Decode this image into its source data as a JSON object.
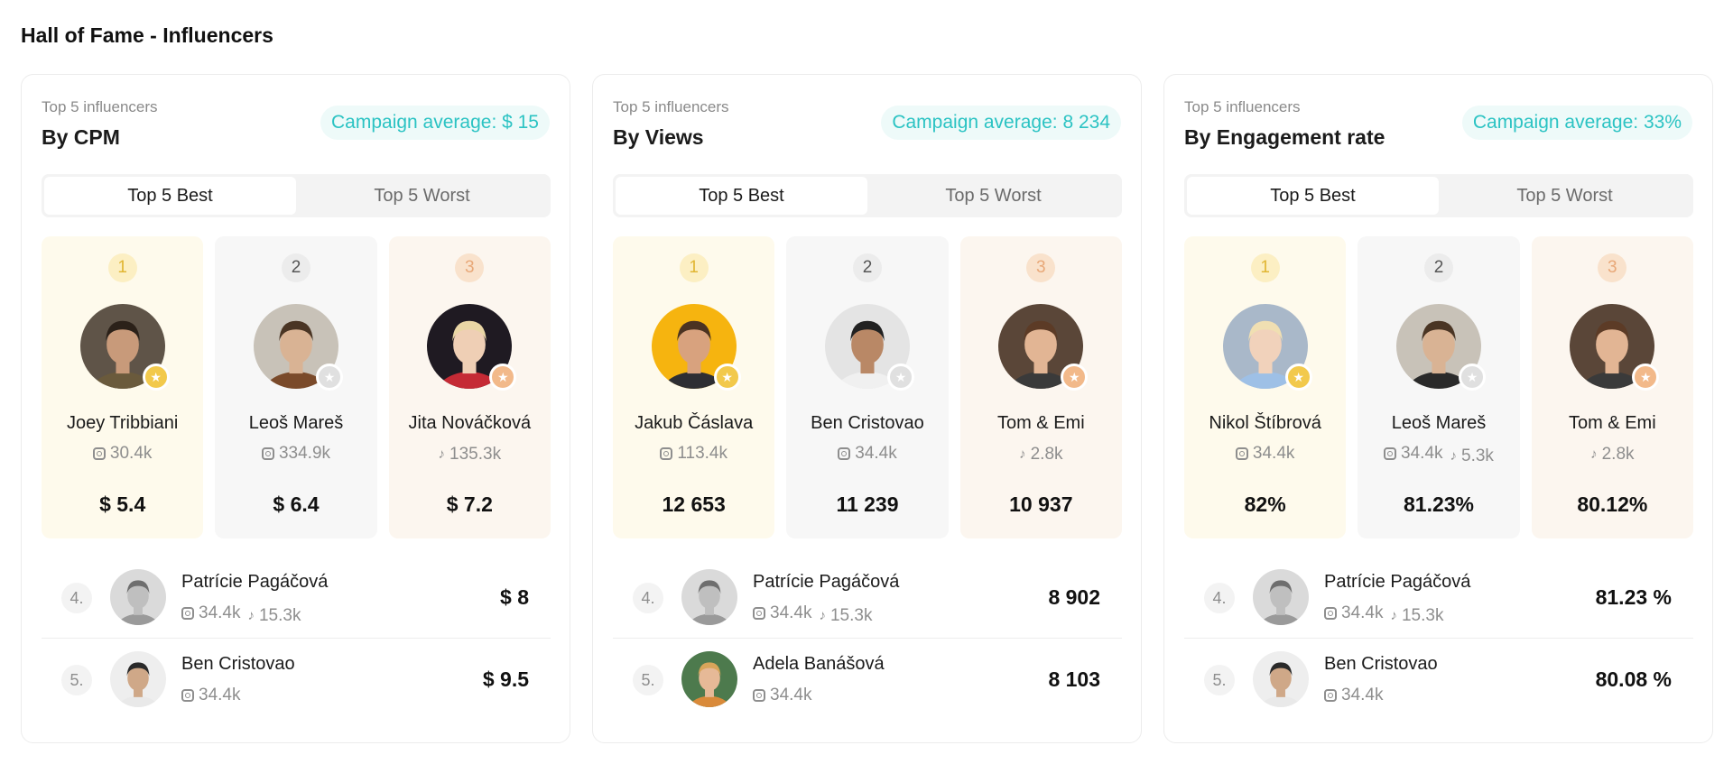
{
  "page": {
    "title": "Hall of Fame - Influencers"
  },
  "icons": {
    "instagram": "instagram-icon",
    "tiktok": "tiktok-icon",
    "medal": "star-medal-icon"
  },
  "colors": {
    "accent_teal": "#2bc3c3",
    "gold": "#f2c94c",
    "silver": "#e0e0e0",
    "bronze": "#f2b98a"
  },
  "cards": [
    {
      "subtitle": "Top 5 influencers",
      "title": "By CPM",
      "average": "Campaign average: $ 15",
      "toggle": {
        "best": "Top 5 Best",
        "worst": "Top 5 Worst",
        "selected": "best"
      },
      "podium": [
        {
          "rank": "1",
          "name": "Joey Tribbiani",
          "stats": [
            {
              "type": "instagram",
              "value": "30.4k"
            }
          ],
          "value": "$ 5.4"
        },
        {
          "rank": "2",
          "name": "Leoš Mareš",
          "stats": [
            {
              "type": "instagram",
              "value": "334.9k"
            }
          ],
          "value": "$ 6.4"
        },
        {
          "rank": "3",
          "name": "Jita Nováčková",
          "stats": [
            {
              "type": "tiktok",
              "value": "135.3k"
            }
          ],
          "value": "$ 7.2"
        }
      ],
      "list": [
        {
          "rank": "4.",
          "name": "Patrície Pagáčová",
          "stats": [
            {
              "type": "instagram",
              "value": "34.4k"
            },
            {
              "type": "tiktok",
              "value": "15.3k"
            }
          ],
          "value": "$ 8"
        },
        {
          "rank": "5.",
          "name": "Ben Cristovao",
          "stats": [
            {
              "type": "instagram",
              "value": "34.4k"
            }
          ],
          "value": "$ 9.5"
        }
      ]
    },
    {
      "subtitle": "Top 5 influencers",
      "title": "By Views",
      "average": "Campaign average: 8 234",
      "toggle": {
        "best": "Top 5 Best",
        "worst": "Top 5 Worst",
        "selected": "best"
      },
      "podium": [
        {
          "rank": "1",
          "name": "Jakub Čáslava",
          "stats": [
            {
              "type": "instagram",
              "value": "113.4k"
            }
          ],
          "value": "12 653"
        },
        {
          "rank": "2",
          "name": "Ben Cristovao",
          "stats": [
            {
              "type": "instagram",
              "value": "34.4k"
            }
          ],
          "value": "11 239"
        },
        {
          "rank": "3",
          "name": "Tom & Emi",
          "stats": [
            {
              "type": "tiktok",
              "value": "2.8k"
            }
          ],
          "value": "10 937"
        }
      ],
      "list": [
        {
          "rank": "4.",
          "name": "Patrície Pagáčová",
          "stats": [
            {
              "type": "instagram",
              "value": "34.4k"
            },
            {
              "type": "tiktok",
              "value": "15.3k"
            }
          ],
          "value": "8 902"
        },
        {
          "rank": "5.",
          "name": "Adela Banášová",
          "stats": [
            {
              "type": "instagram",
              "value": "34.4k"
            }
          ],
          "value": "8 103"
        }
      ]
    },
    {
      "subtitle": "Top 5 influencers",
      "title": "By Engagement rate",
      "average": "Campaign average: 33%",
      "toggle": {
        "best": "Top 5 Best",
        "worst": "Top 5 Worst",
        "selected": "best"
      },
      "podium": [
        {
          "rank": "1",
          "name": "Nikol Štíbrová",
          "stats": [
            {
              "type": "instagram",
              "value": "34.4k"
            }
          ],
          "value": "82%"
        },
        {
          "rank": "2",
          "name": "Leoš Mareš",
          "stats": [
            {
              "type": "instagram",
              "value": "34.4k"
            },
            {
              "type": "tiktok",
              "value": "5.3k"
            }
          ],
          "value": "81.23%"
        },
        {
          "rank": "3",
          "name": "Tom & Emi",
          "stats": [
            {
              "type": "tiktok",
              "value": "2.8k"
            }
          ],
          "value": "80.12%"
        }
      ],
      "list": [
        {
          "rank": "4.",
          "name": "Patrície Pagáčová",
          "stats": [
            {
              "type": "instagram",
              "value": "34.4k"
            },
            {
              "type": "tiktok",
              "value": "15.3k"
            }
          ],
          "value": "81.23 %"
        },
        {
          "rank": "5.",
          "name": "Ben Cristovao",
          "stats": [
            {
              "type": "instagram",
              "value": "34.4k"
            }
          ],
          "value": "80.08 %"
        }
      ]
    }
  ]
}
